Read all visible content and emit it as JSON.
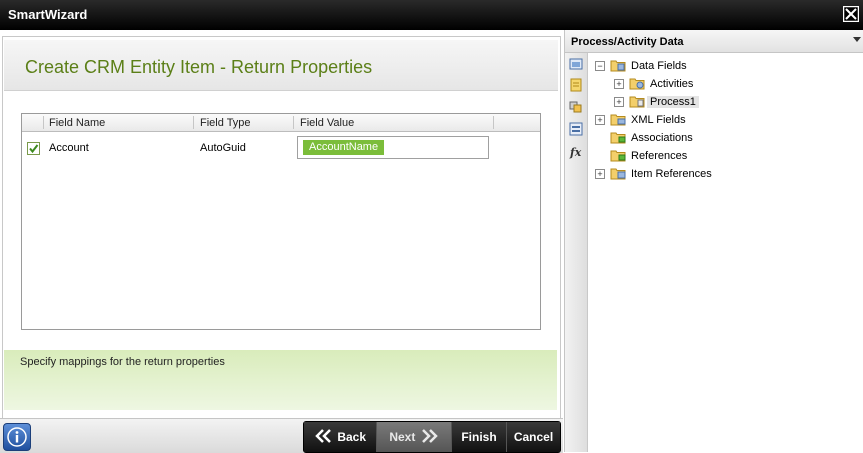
{
  "window": {
    "title": "SmartWizard"
  },
  "page": {
    "title": "Create CRM Entity Item - Return Properties"
  },
  "grid": {
    "columns": [
      "Field Name",
      "Field Type",
      "Field Value"
    ],
    "rows": [
      {
        "checked": true,
        "name": "Account",
        "type": "AutoGuid",
        "value": "AccountName"
      }
    ]
  },
  "instructions": "Specify mappings for the return properties",
  "footer": {
    "back": "Back",
    "next": "Next",
    "finish": "Finish",
    "cancel": "Cancel"
  },
  "panel": {
    "title": "Process/Activity Data",
    "tree": [
      {
        "label": "Data Fields",
        "expander": "−",
        "level": 0
      },
      {
        "label": "Activities",
        "expander": "+",
        "level": 1
      },
      {
        "label": "Process1",
        "expander": "+",
        "level": 1,
        "selected": true
      },
      {
        "label": "XML Fields",
        "expander": "+",
        "level": 0
      },
      {
        "label": "Associations",
        "expander": "",
        "level": 0
      },
      {
        "label": "References",
        "expander": "",
        "level": 0
      },
      {
        "label": "Item References",
        "expander": "+",
        "level": 0
      }
    ]
  },
  "colors": {
    "accent": "#5b7f17",
    "token": "#7bbd3a",
    "instruction_band": "#d9ecbb"
  },
  "icons": [
    "close-icon",
    "info-icon",
    "back-chevron-icon",
    "next-chevron-icon",
    "folder-icon",
    "dropdown-arrow-icon"
  ]
}
